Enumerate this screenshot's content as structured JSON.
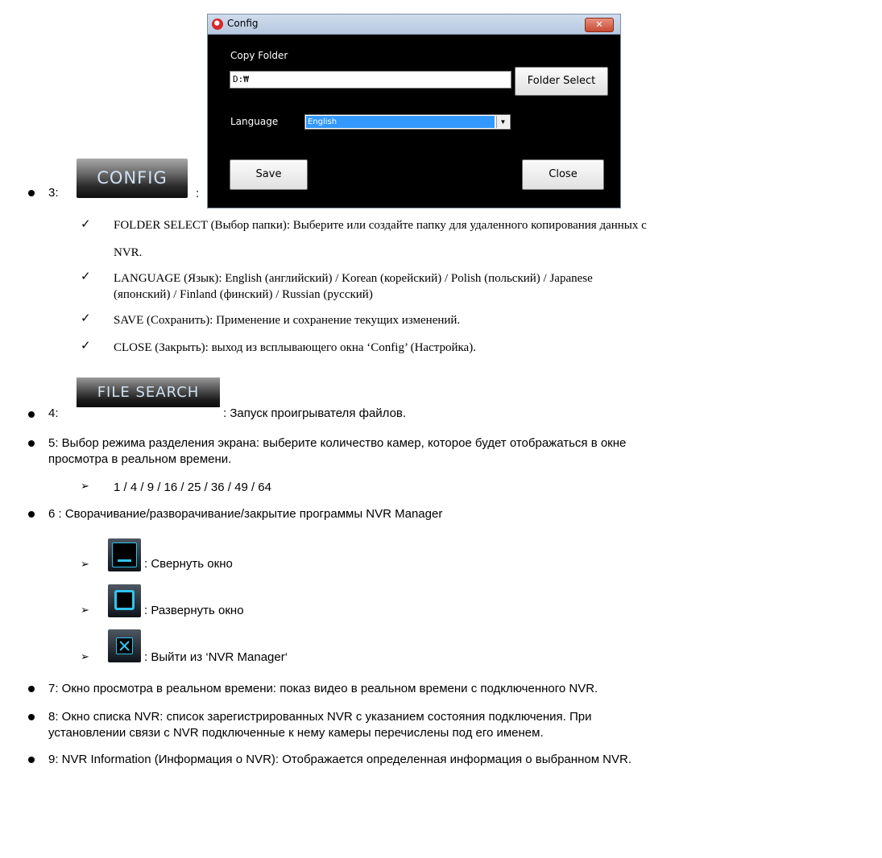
{
  "item3": {
    "number": "3:",
    "button_label": "CONFIG",
    "colon": ":",
    "dialog": {
      "title": "Config",
      "close_glyph": "✕",
      "copy_folder_label": "Copy Folder",
      "copy_folder_value": "D:₩",
      "folder_select_button": "Folder Select",
      "language_label": "Language",
      "language_value": "English",
      "save_button": "Save",
      "close_button": "Close"
    },
    "checks": [
      {
        "line1": "FOLDER SELECT (Выбор папки): Выберите или создайте папку для удаленного копирования данных с",
        "line2": "NVR."
      },
      {
        "line1": "LANGUAGE (Язык): English (английский) / Korean (корейский) / Polish (польский) / Japanese",
        "line2": "(японский) / Finland (финский) / Russian (русский)"
      },
      {
        "line1": "SAVE (Сохранить): Применение и сохранение текущих изменений.",
        "line2": ""
      },
      {
        "line1": "CLOSE (Закрыть): выход из всплывающего окна ‘Config’ (Настройка).",
        "line2": ""
      }
    ],
    "check_mark": "✓"
  },
  "item4": {
    "number": "4:",
    "button_label": "FILE SEARCH",
    "text": ": Запуск проигрывателя файлов."
  },
  "item5": {
    "line1": "5: Выбор режима разделения экрана: выберите количество камер, которое будет отображаться в окне",
    "line2": "просмотра в реальном времени.",
    "sub": "1 / 4 / 9 / 16 / 25 / 36 / 49 / 64"
  },
  "item6": {
    "text": "6 : Сворачивание/разворачивание/закрытие программы NVR Manager",
    "subs": [
      {
        "icon": "minimize-icon",
        "text": ": Свернуть окно"
      },
      {
        "icon": "maximize-icon",
        "text": ": Развернуть окно"
      },
      {
        "icon": "exit-icon",
        "text": ": Выйти из ‘NVR Manager‘"
      }
    ]
  },
  "item7": {
    "text": "7: Окно просмотра в реальном времени: показ видео в реальном времени с подключенного NVR."
  },
  "item8": {
    "line1": "8: Окно списка NVR: список зарегистрированных NVR с указанием состояния подключения. При",
    "line2": "установлении связи с NVR подключенные к нему камеры перечислены под его именем."
  },
  "item9": {
    "text": "9: NVR Information (Информация о NVR): Отображается определенная информация о выбранном NVR."
  },
  "arrow_mark": "➢"
}
